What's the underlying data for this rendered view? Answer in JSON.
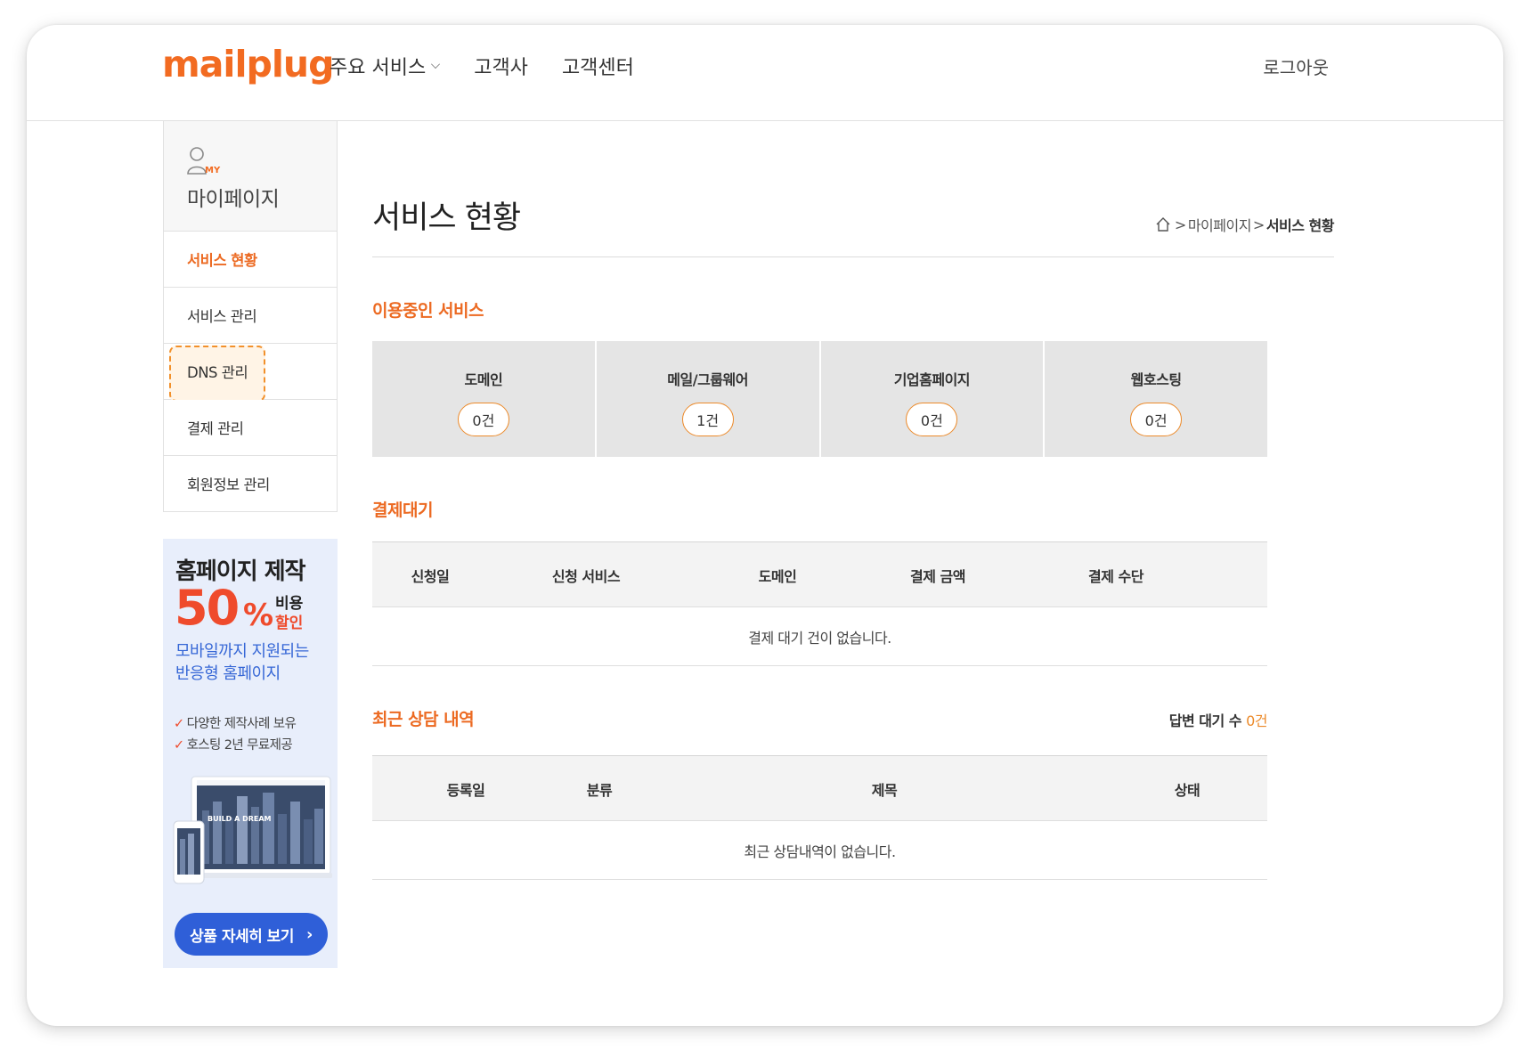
{
  "header": {
    "logo": "mailplug",
    "nav": [
      {
        "label": "주요 서비스"
      },
      {
        "label": "고객사"
      },
      {
        "label": "고객센터"
      }
    ],
    "logout": "로그아웃"
  },
  "sidebar": {
    "my_badge": "MY",
    "title": "마이페이지",
    "items": [
      {
        "label": "서비스 현황"
      },
      {
        "label": "서비스 관리"
      },
      {
        "label": "DNS 관리"
      },
      {
        "label": "결제 관리"
      },
      {
        "label": "회원정보 관리"
      }
    ]
  },
  "banner": {
    "title": "홈페이지 제작",
    "discount": "50",
    "percent": "%",
    "cost_label": "비용",
    "sale_label": "할인",
    "subtitle_line1": "모바일까지 지원되는",
    "subtitle_line2": "반응형 홈페이지",
    "checks": [
      "다양한 제작사례 보유",
      "호스팅 2년 무료제공"
    ],
    "image_text": "BUILD A DREAM",
    "button": "상품 자세히 보기"
  },
  "main": {
    "page_title": "서비스 현황",
    "breadcrumb": {
      "parent": "마이페이지",
      "current": "서비스 현황"
    },
    "in_use": {
      "title": "이용중인 서비스",
      "cards": [
        {
          "label": "도메인",
          "count": "0건"
        },
        {
          "label": "메일/그룹웨어",
          "count": "1건"
        },
        {
          "label": "기업홈페이지",
          "count": "0건"
        },
        {
          "label": "웹호스팅",
          "count": "0건"
        }
      ]
    },
    "payment": {
      "title": "결제대기",
      "headers": [
        "신청일",
        "신청 서비스",
        "도메인",
        "결제 금액",
        "결제 수단"
      ],
      "empty": "결제 대기 건이 없습니다."
    },
    "consult": {
      "title": "최근 상담 내역",
      "pending_label": "답변 대기 수",
      "pending_count": "0건",
      "headers": [
        "등록일",
        "분류",
        "제목",
        "상태"
      ],
      "empty": "최근 상담내역이 없습니다."
    }
  },
  "colors": {
    "accent": "#ec6a22",
    "brand": "#f26b21",
    "banner_blue": "#2f5fd8",
    "banner_red": "#ef4b2c"
  }
}
